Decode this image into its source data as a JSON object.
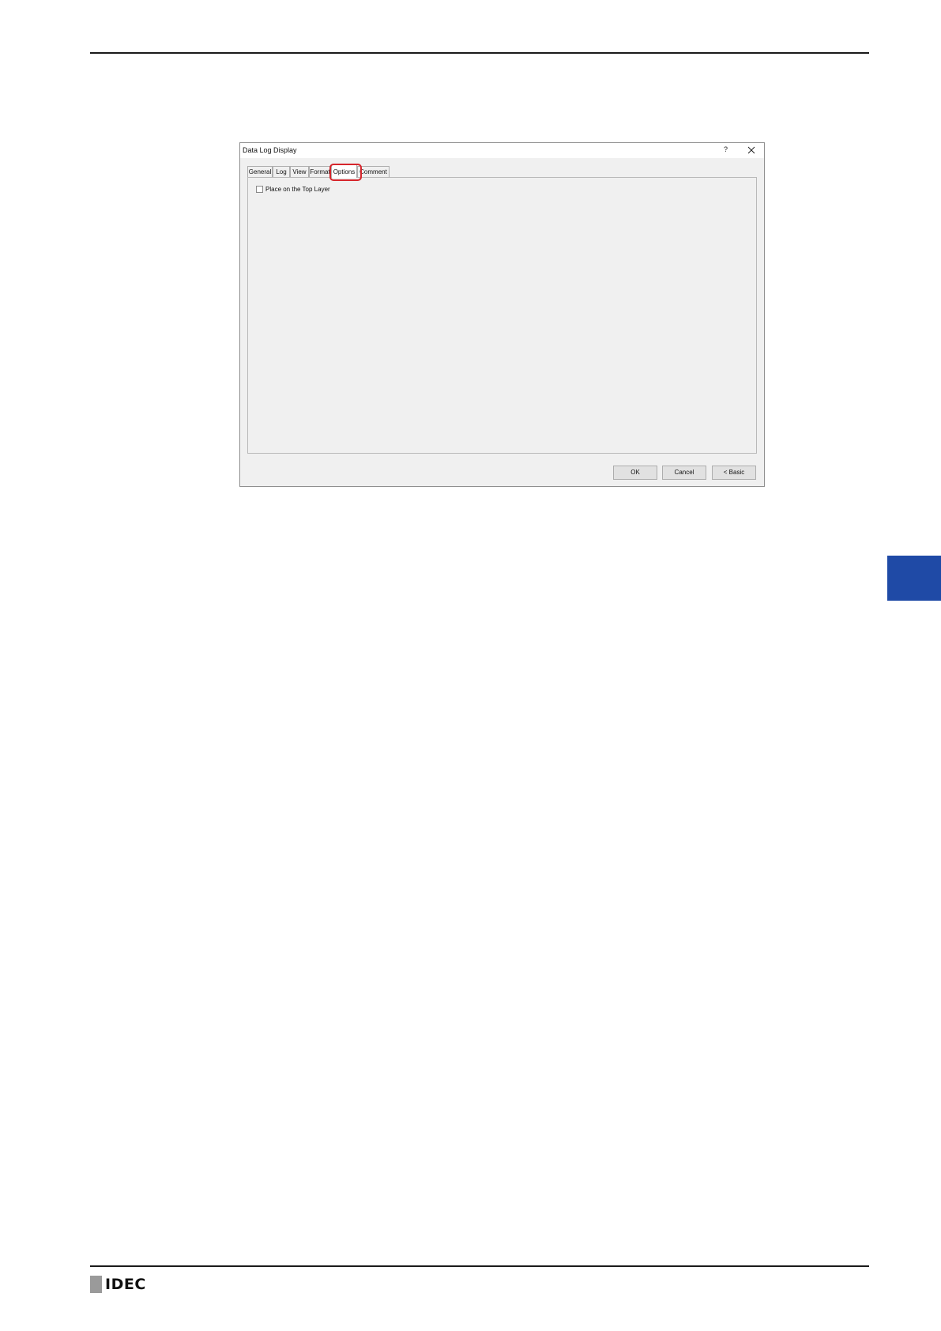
{
  "dialog": {
    "title": "Data Log Display",
    "help_label": "?",
    "tabs": [
      {
        "label": "General",
        "active": false
      },
      {
        "label": "Log",
        "active": false
      },
      {
        "label": "View",
        "active": false
      },
      {
        "label": "Format",
        "active": false
      },
      {
        "label": "Options",
        "active": true
      },
      {
        "label": "Comment",
        "active": false
      }
    ],
    "options": {
      "place_on_top_layer_label": "Place on the Top Layer",
      "place_on_top_layer_checked": false
    },
    "buttons": {
      "ok_label": "OK",
      "cancel_label": "Cancel",
      "basic_label": "< Basic"
    }
  },
  "footer": {
    "logo_text": "IDEC"
  },
  "colors": {
    "highlight": "#d6252b",
    "side_tab": "#1f4aa6"
  }
}
